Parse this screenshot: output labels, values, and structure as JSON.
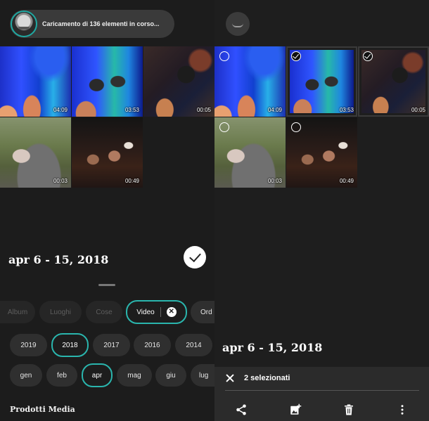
{
  "left": {
    "upload_status": "Caricamento di 136 elementi in corso...",
    "tiles": [
      {
        "duration": "04:09"
      },
      {
        "duration": "03:53"
      },
      {
        "duration": "00:05"
      },
      {
        "duration": "00:03"
      },
      {
        "duration": "00:49"
      }
    ],
    "date_range": "apr 6 - 15, 2018",
    "filter_chips": [
      {
        "label": "Album"
      },
      {
        "label": "Luoghi"
      },
      {
        "label": "Cose"
      },
      {
        "label": "Video"
      },
      {
        "label": "Ord"
      }
    ],
    "years": [
      "2019",
      "2018",
      "2017",
      "2016",
      "2014"
    ],
    "selected_year": "2018",
    "months": [
      "gen",
      "feb",
      "apr",
      "mag",
      "giu",
      "lug"
    ],
    "selected_month": "apr",
    "section_title": "Prodotti Media"
  },
  "right": {
    "tiles": [
      {
        "duration": "04:09",
        "selected": false
      },
      {
        "duration": "03:53",
        "selected": true
      },
      {
        "duration": "00:05",
        "selected": true
      },
      {
        "duration": "00:03",
        "selected": false
      },
      {
        "duration": "00:49",
        "selected": false
      }
    ],
    "date_range": "apr 6 - 15, 2018",
    "selection_count": "2 selezionati",
    "actions": [
      "share-icon",
      "add-to-album-icon",
      "trash-icon",
      "more-vertical-icon"
    ]
  },
  "colors": {
    "accent": "#2ab5ad",
    "background": "#1c1c1c",
    "chip": "#2f2f2f"
  }
}
